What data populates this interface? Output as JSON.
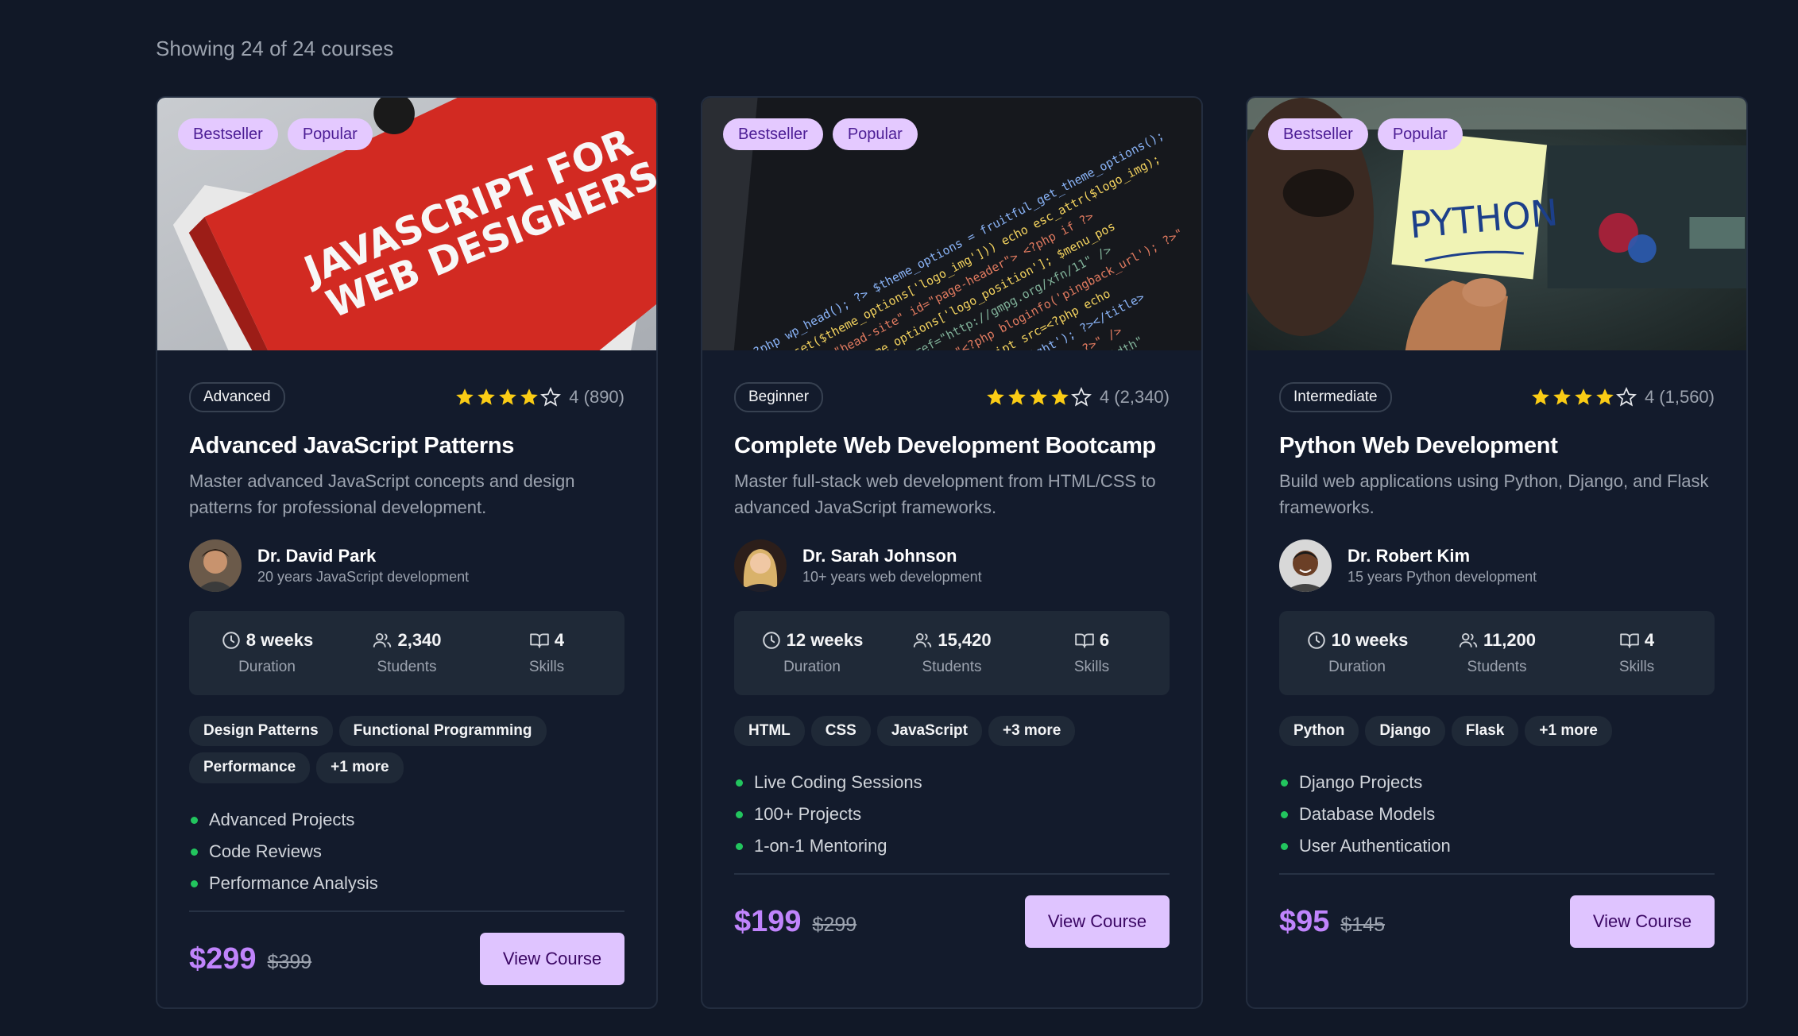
{
  "results": {
    "text": "Showing 24 of 24 courses"
  },
  "colors": {
    "accent": "#c084fc",
    "button": "#dfc4ff",
    "badge": "#e4c9ff",
    "bullet": "#22c55e",
    "star": "#facc15"
  },
  "courses": [
    {
      "badges": [
        "Bestseller",
        "Popular"
      ],
      "level": "Advanced",
      "rating_stars": 4,
      "rating_text": "4 (890)",
      "title": "Advanced JavaScript Patterns",
      "description": "Master advanced JavaScript concepts and design patterns for professional development.",
      "image_icon": "javascript-book-photo",
      "instructor": {
        "name": "Dr. David Park",
        "bio": "20 years JavaScript development"
      },
      "stats": {
        "duration": {
          "value": "8 weeks",
          "label": "Duration",
          "icon": "clock-icon"
        },
        "students": {
          "value": "2,340",
          "label": "Students",
          "icon": "users-icon"
        },
        "skills": {
          "value": "4",
          "label": "Skills",
          "icon": "book-icon"
        }
      },
      "tags": [
        "Design Patterns",
        "Functional Programming",
        "Performance",
        "+1 more"
      ],
      "features": [
        "Advanced Projects",
        "Code Reviews",
        "Performance Analysis"
      ],
      "price": "$299",
      "old_price": "$399",
      "button": "View Course"
    },
    {
      "badges": [
        "Bestseller",
        "Popular"
      ],
      "level": "Beginner",
      "rating_stars": 4,
      "rating_text": "4 (2,340)",
      "title": "Complete Web Development Bootcamp",
      "description": "Master full-stack web development from HTML/CSS to advanced JavaScript frameworks.",
      "image_icon": "code-screen-photo",
      "instructor": {
        "name": "Dr. Sarah Johnson",
        "bio": "10+ years web development"
      },
      "stats": {
        "duration": {
          "value": "12 weeks",
          "label": "Duration",
          "icon": "clock-icon"
        },
        "students": {
          "value": "15,420",
          "label": "Students",
          "icon": "users-icon"
        },
        "skills": {
          "value": "6",
          "label": "Skills",
          "icon": "book-icon"
        }
      },
      "tags": [
        "HTML",
        "CSS",
        "JavaScript",
        "+3 more"
      ],
      "features": [
        "Live Coding Sessions",
        "100+ Projects",
        "1-on-1 Mentoring"
      ],
      "price": "$199",
      "old_price": "$299",
      "button": "View Course"
    },
    {
      "badges": [
        "Bestseller",
        "Popular"
      ],
      "level": "Intermediate",
      "rating_stars": 4,
      "rating_text": "4 (1,560)",
      "title": "Python Web Development",
      "description": "Build web applications using Python, Django, and Flask frameworks.",
      "image_icon": "python-sticky-note-photo",
      "image_text": "PYTHON",
      "instructor": {
        "name": "Dr. Robert Kim",
        "bio": "15 years Python development"
      },
      "stats": {
        "duration": {
          "value": "10 weeks",
          "label": "Duration",
          "icon": "clock-icon"
        },
        "students": {
          "value": "11,200",
          "label": "Students",
          "icon": "users-icon"
        },
        "skills": {
          "value": "4",
          "label": "Skills",
          "icon": "book-icon"
        }
      },
      "tags": [
        "Python",
        "Django",
        "Flask",
        "+1 more"
      ],
      "features": [
        "Django Projects",
        "Database Models",
        "User Authentication"
      ],
      "price": "$95",
      "old_price": "$145",
      "button": "View Course"
    }
  ]
}
